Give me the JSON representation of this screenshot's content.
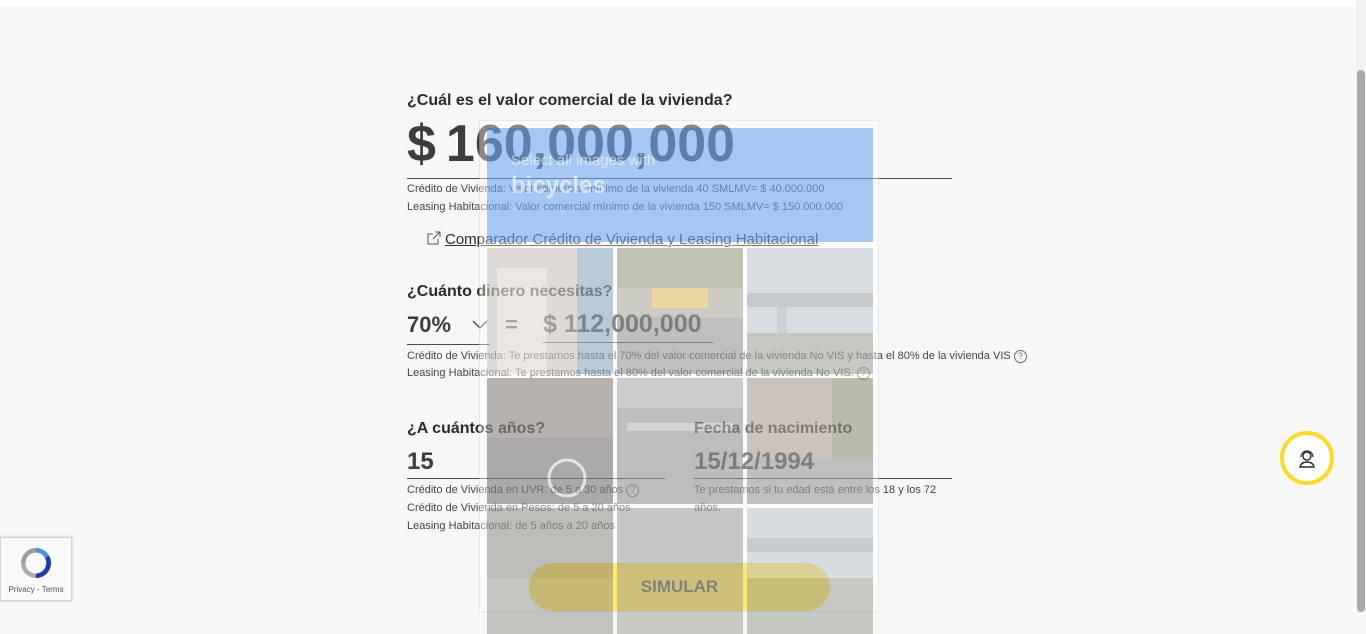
{
  "form": {
    "q1": "¿Cuál es el valor comercial de la vivienda?",
    "currency_symbol": "$",
    "property_value": "160,000,000",
    "note1a": "Crédito de Vivienda: Valor comercial mínimo de la vivienda 40 SMLMV= $ 40.000.000",
    "note1b": "Leasing Habitacional: Valor comercial mínimo de la vivienda 150 SMLMV= $ 150.000.000",
    "comparator_link": "Comparador Crédito de Vivienda y Leasing Habitacional",
    "q2": "¿Cuánto dinero necesitas?",
    "percent_selected": "70%",
    "equals": "=",
    "amount_needed": "$ 112,000,000",
    "note2a": "Crédito de Vivienda: Te prestamos hasta el 70% del valor comercial de la vivienda No VIS y hasta el 80% de la vivienda VIS",
    "note2b": "Leasing Habitacional: Te prestamos hasta el 80% del valor comercial de la vivienda No VIS.",
    "q3": "¿A cuántos años?",
    "years_value": "15",
    "note3a": "Crédito de Vivienda en UVR: de 5 a 30 años",
    "note3b": "Crédito de Vivienda en Pesos: de 5 a 20 años",
    "note3c": "Leasing Habitacional: de 5 años a 20 años",
    "q4": "Fecha de nacimiento",
    "birth_date": "15/12/1994",
    "note4": "Te prestamos si tu edad está entre los 18 y los 72 años.",
    "help_glyph": "?",
    "submit_label": "SIMULAR"
  },
  "captcha": {
    "instruction": "Select all images with",
    "target": "bicycles"
  },
  "recaptcha": {
    "links": "Privacy - Terms"
  },
  "colors": {
    "accent": "#fdda24",
    "text": "#2c2a29",
    "captcha_header": "#1a73e8"
  }
}
